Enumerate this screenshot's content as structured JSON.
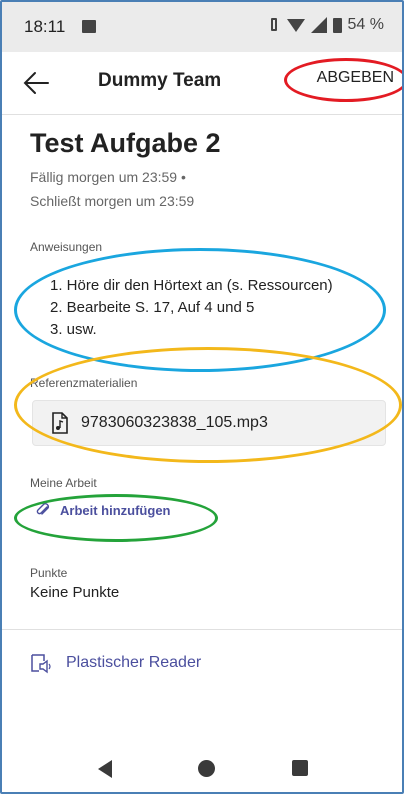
{
  "status_bar": {
    "time": "18:11",
    "battery": "54 %"
  },
  "app_bar": {
    "title": "Dummy Team",
    "submit_label": "ABGEBEN"
  },
  "assignment": {
    "title": "Test Aufgabe 2",
    "due": "Fällig morgen um 23:59   •",
    "closes": "Schließt morgen um 23:59"
  },
  "instructions": {
    "label": "Anweisungen",
    "items": [
      "1. Höre dir den Hörtext an (s. Ressourcen)",
      "2. Bearbeite S. 17, Auf 4 und 5",
      "3. usw."
    ]
  },
  "reference": {
    "label": "Referenzmaterialien",
    "file_name": "9783060323838_105.mp3",
    "file_icon": "audio-file-icon"
  },
  "my_work": {
    "label": "Meine Arbeit",
    "add_label": "Arbeit hinzufügen",
    "add_icon": "paperclip-icon"
  },
  "points": {
    "label": "Punkte",
    "value": "Keine Punkte"
  },
  "reader": {
    "label": "Plastischer Reader",
    "icon": "immersive-reader-icon"
  },
  "annotation_colors": {
    "submit": "#e31b23",
    "instructions": "#1aa6df",
    "reference": "#f3b81b",
    "add_work": "#24a33a"
  },
  "accent_color": "#4b4f9e"
}
